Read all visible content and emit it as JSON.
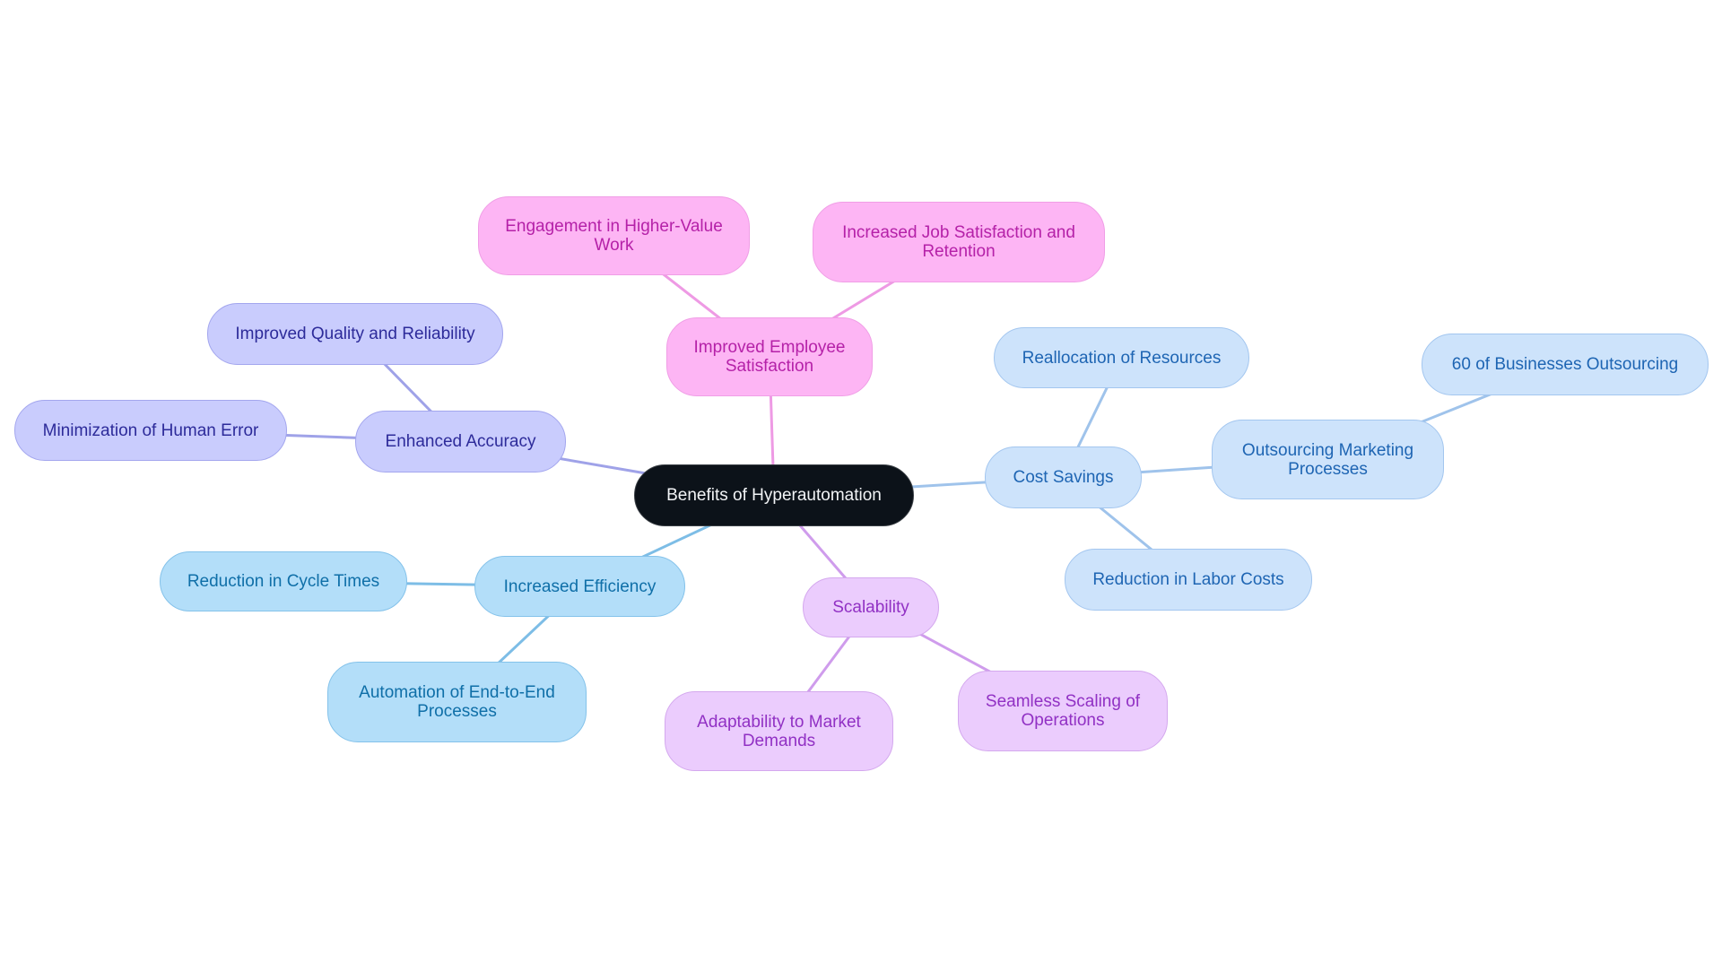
{
  "title": "Benefits of Hyperautomation",
  "colors": {
    "root": "#0c1219",
    "employee_satisfaction": "#fdb5f4",
    "accuracy": "#c9ccfd",
    "efficiency": "#b3def9",
    "scalability": "#ebccfd",
    "cost_savings": "#cde3fb",
    "edge_pink": "#ee9ae4",
    "edge_indigo": "#9fa2e8",
    "edge_sky": "#7dbde6",
    "edge_violet": "#cf9cec",
    "edge_blue": "#9fc3eb"
  },
  "nodes": {
    "root": "Benefits of Hyperautomation",
    "employee": "Improved Employee Satisfaction",
    "engagement": "Engagement in Higher-Value Work",
    "job_satisfaction": "Increased Job Satisfaction and Retention",
    "accuracy": "Enhanced Accuracy",
    "quality": "Improved Quality and Reliability",
    "human_error": "Minimization of Human Error",
    "efficiency": "Increased Efficiency",
    "cycle_times": "Reduction in Cycle Times",
    "end_to_end": "Automation of End-to-End Processes",
    "scalability": "Scalability",
    "adaptability": "Adaptability to Market Demands",
    "seamless": "Seamless Scaling of Operations",
    "cost_savings": "Cost Savings",
    "reallocation": "Reallocation of Resources",
    "outsourcing": "Outsourcing Marketing Processes",
    "sixty_percent": "60 of Businesses Outsourcing",
    "labor_costs": "Reduction in Labor Costs"
  },
  "edges": [
    {
      "from": "root",
      "to": "employee",
      "color": "edge_pink"
    },
    {
      "from": "employee",
      "to": "engagement",
      "color": "edge_pink"
    },
    {
      "from": "employee",
      "to": "job_satisfaction",
      "color": "edge_pink"
    },
    {
      "from": "root",
      "to": "accuracy",
      "color": "edge_indigo"
    },
    {
      "from": "accuracy",
      "to": "quality",
      "color": "edge_indigo"
    },
    {
      "from": "accuracy",
      "to": "human_error",
      "color": "edge_indigo"
    },
    {
      "from": "root",
      "to": "efficiency",
      "color": "edge_sky"
    },
    {
      "from": "efficiency",
      "to": "cycle_times",
      "color": "edge_sky"
    },
    {
      "from": "efficiency",
      "to": "end_to_end",
      "color": "edge_sky"
    },
    {
      "from": "root",
      "to": "scalability",
      "color": "edge_violet"
    },
    {
      "from": "scalability",
      "to": "adaptability",
      "color": "edge_violet"
    },
    {
      "from": "scalability",
      "to": "seamless",
      "color": "edge_violet"
    },
    {
      "from": "root",
      "to": "cost_savings",
      "color": "edge_blue"
    },
    {
      "from": "cost_savings",
      "to": "reallocation",
      "color": "edge_blue"
    },
    {
      "from": "cost_savings",
      "to": "outsourcing",
      "color": "edge_blue"
    },
    {
      "from": "outsourcing",
      "to": "sixty_percent",
      "color": "edge_blue"
    },
    {
      "from": "cost_savings",
      "to": "labor_costs",
      "color": "edge_blue"
    }
  ]
}
